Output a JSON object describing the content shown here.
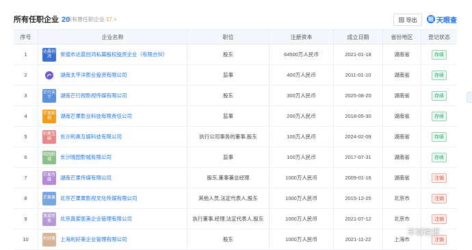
{
  "header": {
    "title": "所有任职企业",
    "title_count": "20",
    "subtab": "所有曾任职企业",
    "subtab_count": "17",
    "subtab_arrow": ">",
    "export_label": "导出",
    "brand_label": "天眼查",
    "brand_glyph": "眼"
  },
  "columns": [
    "序号",
    "企业名称",
    "职位",
    "注册资本",
    "成立日期",
    "省份地区",
    "登记状态"
  ],
  "rows": [
    {
      "idx": "1",
      "logo_text": "达晨创鸿",
      "logo_color": "#3a6fd0",
      "name": "常德市达晨创鸿私募股权投资企业（有限合伙）",
      "position": "股东",
      "capital": "64500万人民币",
      "date": "2021-01-18",
      "region": "湖南省",
      "status": "存续",
      "status_type": "ok"
    },
    {
      "idx": "2",
      "logo_text": "",
      "logo_color": "#ffffff",
      "name": "湖南太平洋影业投资有限公司",
      "position": "监事",
      "capital": "400万人民币",
      "date": "2011-01-10",
      "region": "湖南省",
      "status": "存续",
      "status_type": "ok"
    },
    {
      "idx": "3",
      "logo_text": "芒行天下",
      "logo_color": "#5b8fe0",
      "name": "湖南芒行视影视传媒有限公司",
      "position": "股东",
      "capital": "300万人民币",
      "date": "2025-08-20",
      "region": "湖南省",
      "status": "存续",
      "status_type": "ok"
    },
    {
      "idx": "4",
      "logo_text": "芒果影视",
      "logo_color": "#f39b1b",
      "name": "湖南芒果影业科技有限责任公司",
      "position": "监事",
      "capital": "200万人民币",
      "date": "2018-05-30",
      "region": "湖南省",
      "status": "存续",
      "status_type": "ok"
    },
    {
      "idx": "5",
      "logo_text": "利奥互娱",
      "logo_color": "#e58a8a",
      "name": "长沙利奥互娱科技有限公司",
      "position": "执行公司事务的董事,股东",
      "capital": "100万人民币",
      "date": "2024-02-09",
      "region": "湖南省",
      "status": "存续",
      "status_type": "ok"
    },
    {
      "idx": "6",
      "logo_text": "晓园影城",
      "logo_color": "#8bbf8b",
      "name": "长沙晓园影城有限公司",
      "position": "监事",
      "capital": "100万人民币",
      "date": "2017-07-31",
      "region": "湖南省",
      "status": "存续",
      "status_type": "ok"
    },
    {
      "idx": "7",
      "logo_text": "芒果传媒",
      "logo_color": "#b58ad6",
      "name": "湖南芒果传媒有限公司",
      "position": "股东,董事兼总经理",
      "capital": "1000万人民币",
      "date": "2009-01-16",
      "region": "湖南省",
      "status": "注销",
      "status_type": "off"
    },
    {
      "idx": "8",
      "logo_text": "芒果果",
      "logo_color": "#7aa6e0",
      "name": "北京芒果果影视文化传媒有限公司",
      "position": "其他人员,法定代表人,股东",
      "capital": "1000万人民币",
      "date": "2015-12-25",
      "region": "北京市",
      "status": "注销",
      "status_type": "off"
    },
    {
      "idx": "9",
      "logo_text": "真爱医美",
      "logo_color": "#b39ad6",
      "name": "北京真爱医美企业管理有限公司",
      "position": "执行董事,经理,法定代表人,股东",
      "capital": "1000万人民币",
      "date": "2021-07-12",
      "region": "北京市",
      "status": "注销",
      "status_type": "off"
    },
    {
      "idx": "10",
      "logo_text": "利好美",
      "logo_color": "#d6b49a",
      "name": "上海利好美企业管理有限公司",
      "position": "股东",
      "capital": "1000万人民币",
      "date": "2021-11-22",
      "region": "上海市",
      "status": "注销",
      "status_type": "off"
    }
  ],
  "watermark": {
    "text": "羊城晚报"
  },
  "colors": {
    "accent": "#1a74e8",
    "ok": "#19a765",
    "off": "#e3452d",
    "header_bg": "#f4f7fc"
  }
}
